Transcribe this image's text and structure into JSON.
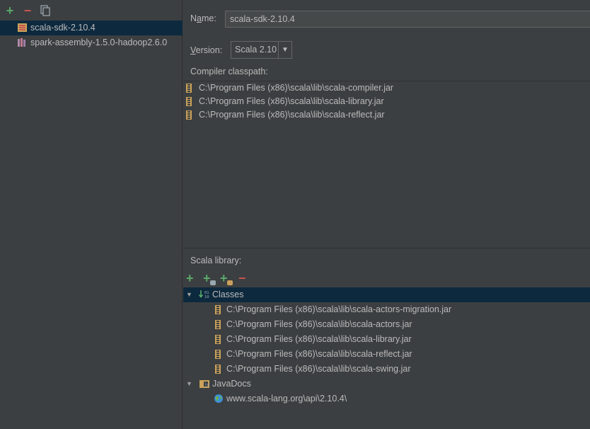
{
  "left": {
    "toolbar": {
      "add": "+",
      "remove": "−"
    },
    "libraries": [
      {
        "label": "scala-sdk-2.10.4",
        "icon": "scala-sdk-icon",
        "selected": true
      },
      {
        "label": "spark-assembly-1.5.0-hadoop2.6.0",
        "icon": "library-icon",
        "selected": false
      }
    ]
  },
  "form": {
    "name_label": "Name:",
    "name_value": "scala-sdk-2.10.4",
    "version_label": "Version:",
    "version_value": "Scala 2.10",
    "compiler_classpath_label": "Compiler classpath:"
  },
  "compiler_classpath": [
    "C:\\Program Files (x86)\\scala\\lib\\scala-compiler.jar",
    "C:\\Program Files (x86)\\scala\\lib\\scala-library.jar",
    "C:\\Program Files (x86)\\scala\\lib\\scala-reflect.jar"
  ],
  "scala_library": {
    "label": "Scala library:",
    "classes_label": "Classes",
    "classes": [
      "C:\\Program Files (x86)\\scala\\lib\\scala-actors-migration.jar",
      "C:\\Program Files (x86)\\scala\\lib\\scala-actors.jar",
      "C:\\Program Files (x86)\\scala\\lib\\scala-library.jar",
      "C:\\Program Files (x86)\\scala\\lib\\scala-reflect.jar",
      "C:\\Program Files (x86)\\scala\\lib\\scala-swing.jar"
    ],
    "javadocs_label": "JavaDocs",
    "javadocs": [
      "www.scala-lang.org\\api\\2.10.4\\"
    ]
  },
  "colors": {
    "background": "#3c3f41",
    "selection": "#0d293e",
    "text": "#bbbbbb",
    "add_green": "#59a869",
    "remove_red": "#c75450",
    "jar_gold": "#c9a15a"
  }
}
